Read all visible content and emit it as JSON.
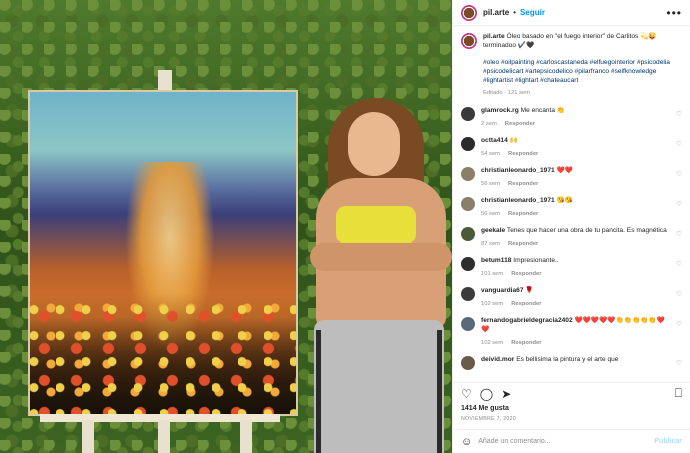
{
  "post": {
    "username": "pil.arte",
    "separator": "•",
    "follow_label": "Seguir",
    "more_label": "•••"
  },
  "caption": {
    "username": "pil.arte",
    "text": "Óleo basado en \"el fuego interior\" de Carlitos 💫😜 terminadoo ✔️🖤",
    "hashtags": "#oleo #oilpainting #carloscastaneda #elfuegointerior #psicodelia #psicodelicart #artepsicodelico #pilarfranco #selfknowledge #lightartist #lightart #chateaucart",
    "meta": "Editado · 121 sem"
  },
  "comments": [
    {
      "user": "glamrock.rg",
      "text": "Me encanta 👏",
      "time": "2 sem",
      "reply": "Responder",
      "avatar_color": "#3a3a3a"
    },
    {
      "user": "octta414",
      "text": "🙌",
      "time": "54 sem",
      "reply": "Responder",
      "avatar_color": "#2b2b2b"
    },
    {
      "user": "christianleonardo_1971",
      "text": "❤️❤️",
      "time": "56 sem",
      "reply": "Responder",
      "avatar_color": "#8a7f6a"
    },
    {
      "user": "christianleonardo_1971",
      "text": "😘😘",
      "time": "56 sem",
      "reply": "Responder",
      "avatar_color": "#8a7f6a"
    },
    {
      "user": "geekale",
      "text": "Tenes que hacer una obra de tu pancita. Es magnética",
      "time": "87 sem",
      "reply": "Responder",
      "avatar_color": "#4a5a3a"
    },
    {
      "user": "betum118",
      "text": "Impresionante..",
      "time": "101 sem",
      "reply": "Responder",
      "avatar_color": "#2e2e2e"
    },
    {
      "user": "vanguardia67",
      "text": "🌹",
      "time": "102 sem",
      "reply": "Responder",
      "avatar_color": "#3b3b3b"
    },
    {
      "user": "fernandogabrieldegracia2402",
      "text": "❤️❤️❤️❤️❤️👏👏👏👏👏❤️❤️",
      "time": "102 sem",
      "reply": "Responder",
      "avatar_color": "#5a6a7a"
    },
    {
      "user": "deivid.mor",
      "text": "Es bellisima la pintura y el arte que",
      "time": "",
      "reply": "",
      "avatar_color": "#6a5a4a"
    }
  ],
  "actions": {
    "like_icon": "heart-icon",
    "comment_icon": "comment-icon",
    "share_icon": "share-icon",
    "save_icon": "bookmark-icon"
  },
  "likes": "1414 Me gusta",
  "date": "NOVIEMBRE 7, 2020",
  "add_comment": {
    "placeholder": "Añade un comentario...",
    "publish_label": "Publicar"
  }
}
